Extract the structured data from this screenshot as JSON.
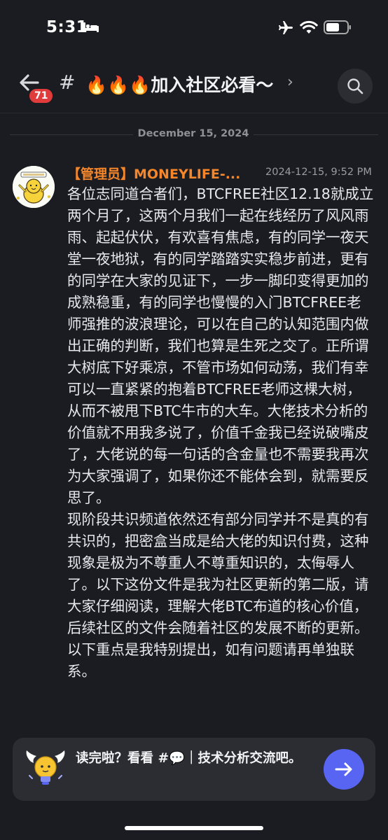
{
  "status_bar": {
    "time": "5:31"
  },
  "header": {
    "unread_count": "71",
    "hash": "#",
    "channel_name": "🔥🔥🔥加入社区必看～",
    "chevron": "›"
  },
  "date_divider": "December 15, 2024",
  "message": {
    "author": "【管理员】MONEYLIFE-...",
    "timestamp": "2024-12-15, 9:52 PM",
    "paragraph_1": "各位志同道合者们，BTCFREE社区12.18就成立两个月了，这两个月我们一起在线经历了风风雨雨、起起伏伏，有欢喜有焦虑，有的同学一夜天堂一夜地狱，有的同学踏踏实实稳步前进，更有的同学在大家的见证下，一步一脚印变得更加的成熟稳重，有的同学也慢慢的入门BTCFREE老师强推的波浪理论，可以在自己的认知范围内做出正确的判断，我们也算是生死之交了。正所谓大树底下好乘凉，不管市场如何动荡，我们有幸可以一直紧紧的抱着BTCFREE老师这棵大树，从而不被甩下BTC牛市的大车。大佬技术分析的价值就不用我多说了，价值千金我已经说破嘴皮了，大佬说的每一句话的含金量也不需要我再次为大家强调了，如果你还不能体会到，就需要反思了。",
    "paragraph_2": "现阶段共识频道依然还有部分同学并不是真的有共识的，把密盒当成是给大佬的知识付费，这种现象是极为不尊重人不尊重知识的，太侮辱人了。以下这份文件是我为社区更新的第二版，请大家仔细阅读，理解大佬BTC布道的核心价值，后续社区的文件会随着社区的发展不断的更新。以下重点是我特别提出，如有问题请再单独联系。"
  },
  "prompt": {
    "text": "读完啦？看看 #💬｜技术分析交流吧。"
  },
  "colors": {
    "background": "#1b1c21",
    "author": "#f5862a",
    "badge": "#e03c3c",
    "accent_button": "#5865f2"
  }
}
